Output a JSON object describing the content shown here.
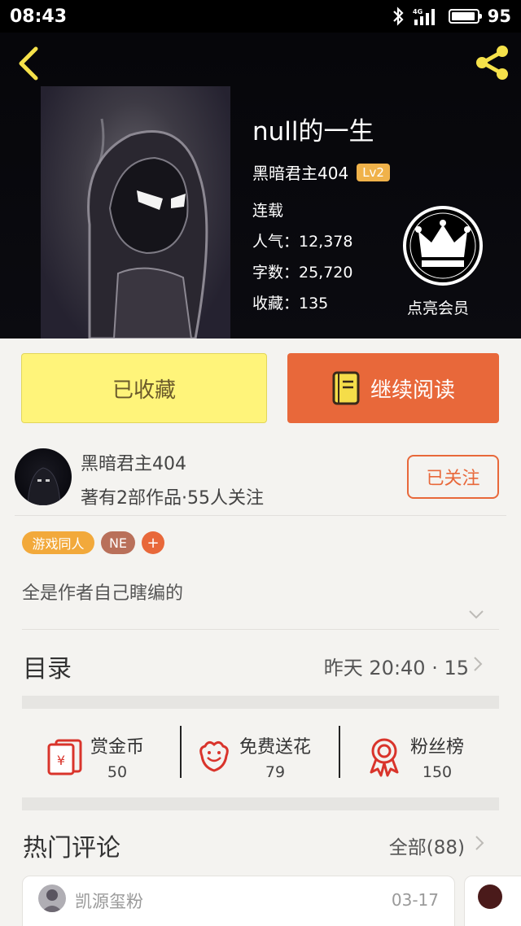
{
  "status": {
    "time": "08:43",
    "network": "4G",
    "battery": "95",
    "battery_level": 0.95
  },
  "book": {
    "title": "null的一生",
    "author": "黑暗君主404",
    "level": "Lv2",
    "status": "连载",
    "popularity": "人气：12,378",
    "words": "字数：25,720",
    "favorites": "收藏：135",
    "vip_label": "点亮会员"
  },
  "actions": {
    "favorited": "已收藏",
    "continue_reading": "继续阅读"
  },
  "author": {
    "name": "黑暗君主404",
    "desc": "著有2部作品·55人关注",
    "follow_state": "已关注"
  },
  "tags": [
    {
      "label": "游戏同人",
      "color": "#f2a93b"
    },
    {
      "label": "NE",
      "color": "#b9705a"
    },
    {
      "label": "+",
      "color": "#e8683a"
    }
  ],
  "intro": "全是作者自己瞎编的",
  "toc": {
    "label": "目录",
    "info": "昨天 20:40 · 15"
  },
  "rewards": [
    {
      "label": "赏金币",
      "value": "50",
      "icon": "red-envelope-icon"
    },
    {
      "label": "免费送花",
      "value": "79",
      "icon": "flower-icon"
    },
    {
      "label": "粉丝榜",
      "value": "150",
      "icon": "medal-icon"
    }
  ],
  "comments": {
    "label": "热门评论",
    "all": "全部(88)",
    "first": {
      "user": "凯源玺粉",
      "date": "03-17"
    }
  },
  "colors": {
    "accent": "#e8683a",
    "button_yellow": "#fff47a",
    "icon_yellow": "#f5e14a",
    "icon_red": "#d9342b"
  }
}
